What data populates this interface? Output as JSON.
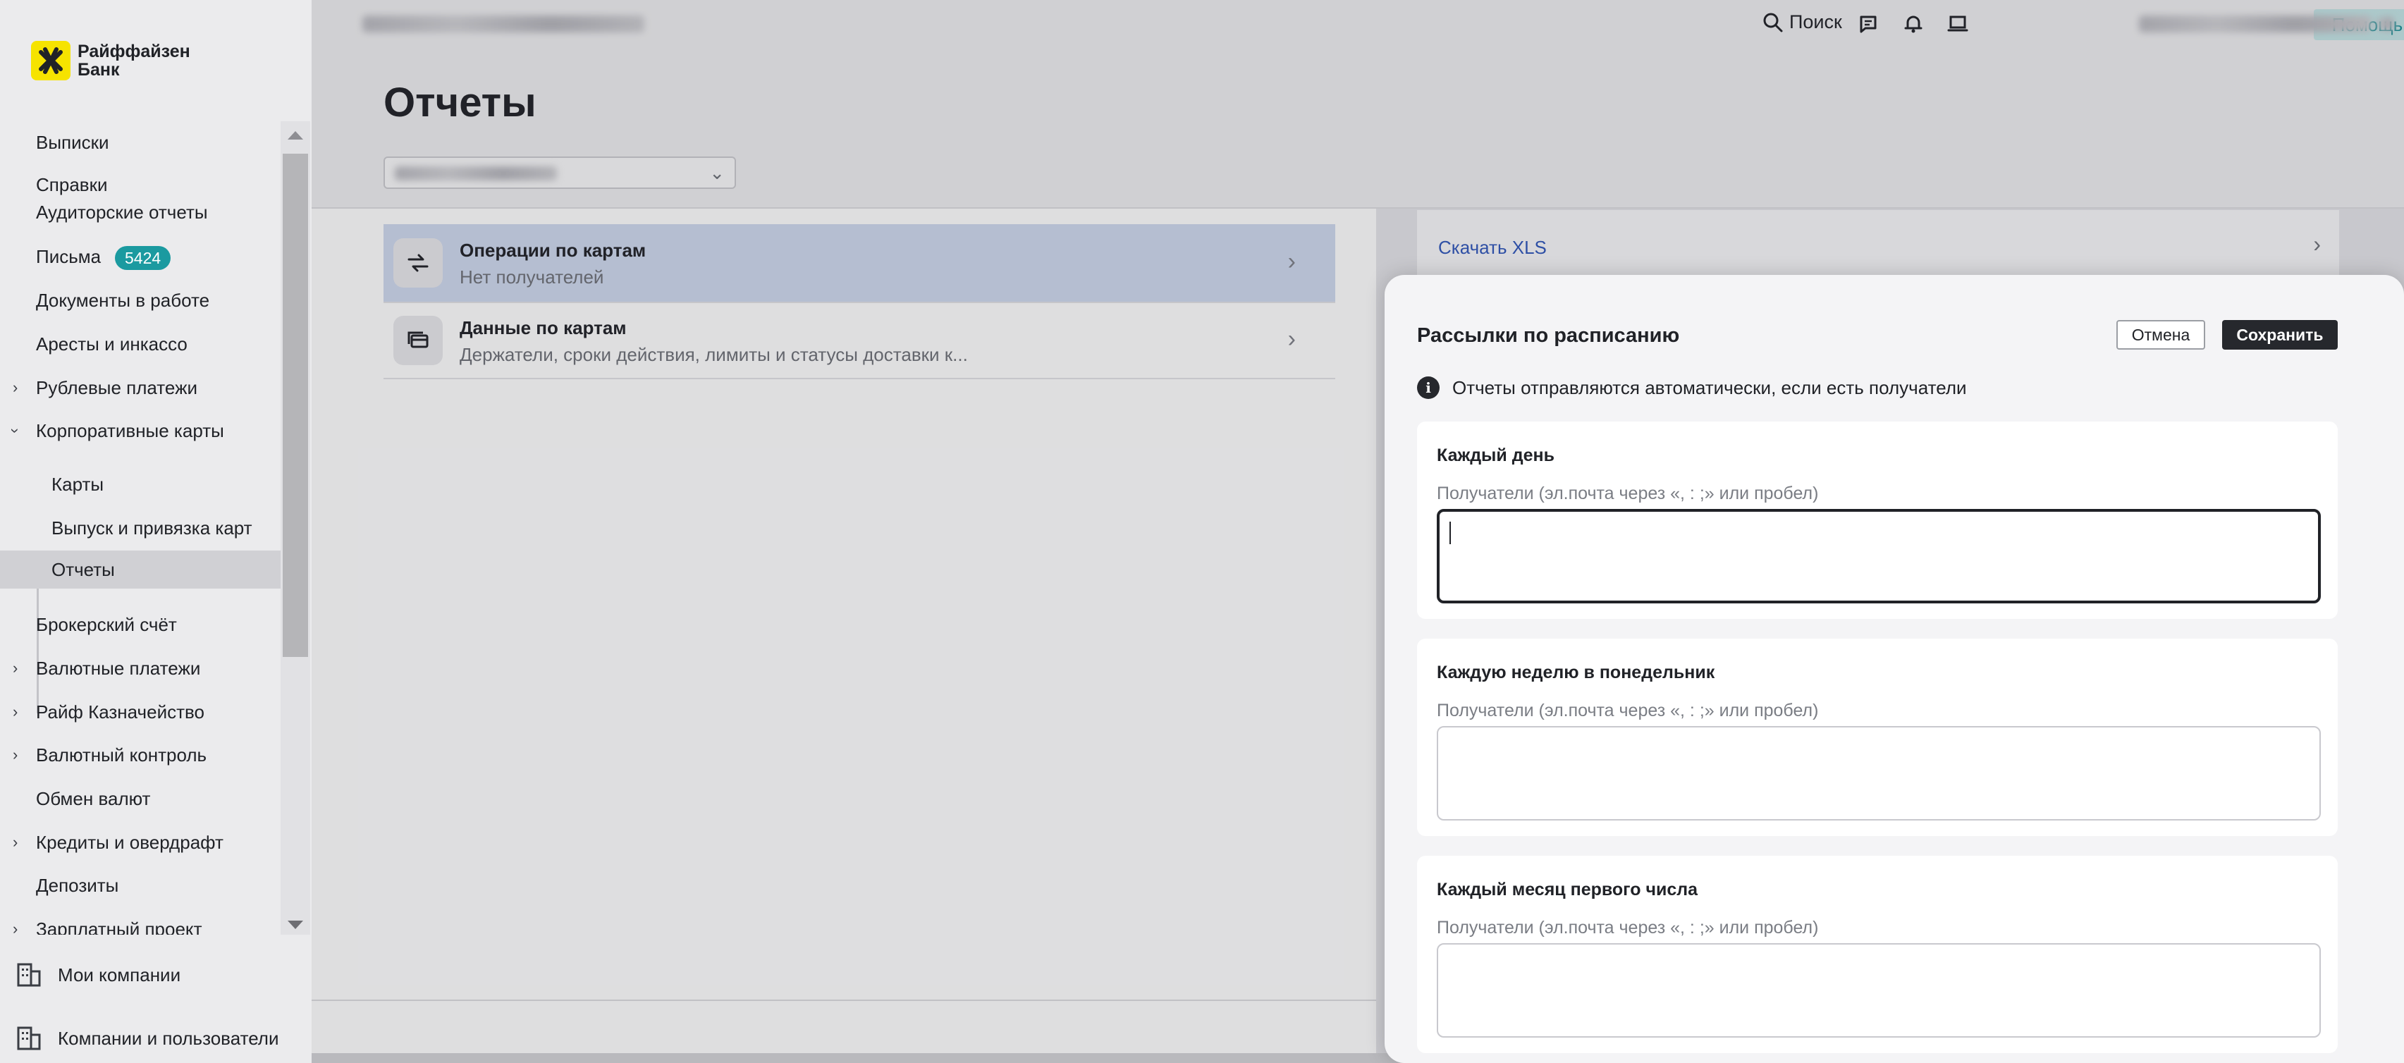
{
  "bank": {
    "name_line1": "Райффайзен",
    "name_line2": "Банк"
  },
  "sidebar": {
    "items": [
      {
        "label": "Выписки",
        "expandable": false
      },
      {
        "label": "Справки",
        "expandable": false
      },
      {
        "label": "Аудиторские отчеты",
        "expandable": false
      },
      {
        "label": "Письма",
        "expandable": false,
        "badge": "5424"
      },
      {
        "label": "Документы в работе",
        "expandable": false
      },
      {
        "label": "Аресты и инкассо",
        "expandable": false
      },
      {
        "label": "Рублевые платежи",
        "expandable": true
      },
      {
        "label": "Корпоративные карты",
        "expandable": true,
        "expanded": true
      },
      {
        "label": "Карты",
        "sub": true
      },
      {
        "label": "Выпуск и привязка карт",
        "sub": true
      },
      {
        "label": "Отчеты",
        "sub": true,
        "active": true
      },
      {
        "label": "Брокерский счёт",
        "expandable": false
      },
      {
        "label": "Валютные платежи",
        "expandable": true
      },
      {
        "label": "Райф Казначейство",
        "expandable": true
      },
      {
        "label": "Валютный контроль",
        "expandable": true
      },
      {
        "label": "Обмен валют",
        "expandable": false
      },
      {
        "label": "Кредиты и овердрафт",
        "expandable": true
      },
      {
        "label": "Депозиты",
        "expandable": false
      },
      {
        "label": "Зарплатный проект",
        "expandable": true
      }
    ],
    "bottom": {
      "my_companies": "Мои компании",
      "companies_users": "Компании и пользователи"
    }
  },
  "topbar": {
    "search": "Поиск",
    "help": "Помощь"
  },
  "page": {
    "title": "Отчеты"
  },
  "reports": [
    {
      "title": "Операции по картам",
      "subtitle": "Нет получателей",
      "icon": "card-transfer-icon",
      "selected": true
    },
    {
      "title": "Данные по картам",
      "subtitle": "Держатели, сроки действия, лимиты и статусы доставки к...",
      "icon": "cards-stack-icon",
      "selected": false
    }
  ],
  "download": {
    "label": "Скачать XLS"
  },
  "drawer": {
    "title": "Рассылки по расписанию",
    "cancel": "Отмена",
    "save": "Сохранить",
    "info": "Отчеты отправляются автоматически, если есть получатели",
    "schedules": [
      {
        "title": "Каждый день",
        "label": "Получатели (эл.почта через «, : ;» или пробел)",
        "value": "",
        "focused": true
      },
      {
        "title": "Каждую неделю в понедельник",
        "label": "Получатели (эл.почта через «, : ;» или пробел)",
        "value": "",
        "focused": false
      },
      {
        "title": "Каждый месяц первого числа",
        "label": "Получатели (эл.почта через «, : ;» или пробел)",
        "value": "",
        "focused": false
      }
    ]
  },
  "colors": {
    "accent_teal": "#1b9aa0",
    "selected_row": "#c9d3e8",
    "link_blue": "#2f55b5",
    "logo_yellow": "#f6e300"
  }
}
